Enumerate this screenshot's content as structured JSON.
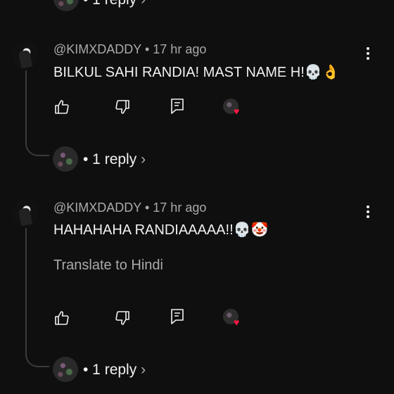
{
  "top_reply": {
    "count_label": "• 1 reply"
  },
  "comments": [
    {
      "author": "@KIMXDADDY",
      "time": "• 17 hr ago",
      "text": "BILKUL SAHI RANDIA! MAST NAME H!💀👌",
      "reply_label": "• 1 reply"
    },
    {
      "author": "@KIMXDADDY",
      "time": "• 17 hr ago",
      "text": "HAHAHAHA RANDIAAAAA!!💀🤡",
      "translate_label": "Translate to Hindi",
      "reply_label": "• 1 reply"
    }
  ],
  "icons": {
    "like": "thumb-up-icon",
    "dislike": "thumb-down-icon",
    "reply": "comment-icon",
    "more": "more-vert-icon",
    "chevron": "chevron-right-icon",
    "heart_color": "#ff1744"
  }
}
